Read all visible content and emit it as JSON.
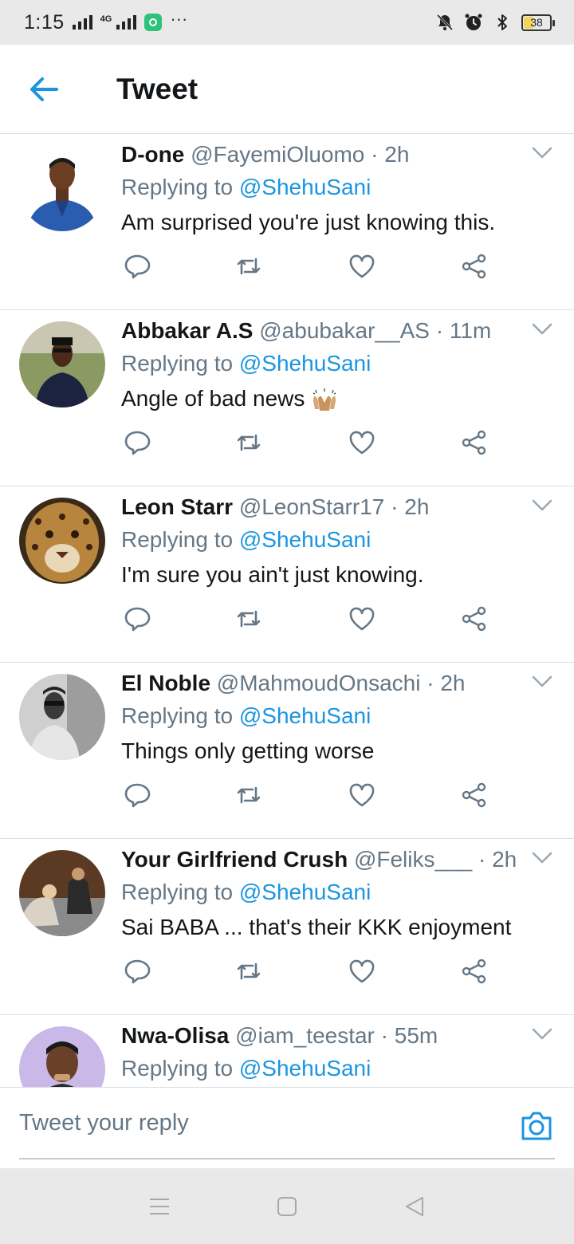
{
  "status_bar": {
    "time": "1:15",
    "network": "4G",
    "battery": "38",
    "icons": [
      "signal-icon",
      "signal-4g-icon",
      "app-notification-icon",
      "more-dots-icon",
      "mute-vibrate-icon",
      "alarm-icon",
      "bluetooth-icon",
      "battery-icon"
    ]
  },
  "header": {
    "back_icon": "back-arrow-icon",
    "title": "Tweet"
  },
  "colors": {
    "accent": "#1b95e0",
    "text_primary": "#14171a",
    "text_secondary": "#657786",
    "divider": "#d9dee2"
  },
  "tweets": [
    {
      "name": "D-one",
      "handle": "@FayemiOluomo",
      "time": "2h",
      "replying_prefix": "Replying to",
      "replying_to": "@ShehuSani",
      "text": "Am surprised you're just knowing this."
    },
    {
      "name": "Abbakar A.S",
      "handle": "@abubakar__AS",
      "time": "11m",
      "replying_prefix": "Replying to",
      "replying_to": "@ShehuSani",
      "text": "Angle of bad news",
      "emoji": "raising-hands-emoji"
    },
    {
      "name": "Leon Starr",
      "handle": "@LeonStarr17",
      "time": "2h",
      "replying_prefix": "Replying to",
      "replying_to": "@ShehuSani",
      "text": "I'm sure you ain't just knowing."
    },
    {
      "name": "El Noble",
      "handle": "@MahmoudOnsachi",
      "time": "2h",
      "replying_prefix": "Replying to",
      "replying_to": "@ShehuSani",
      "text": "Things only getting worse"
    },
    {
      "name": "Your Girlfriend Crush",
      "handle": "@Feliks___",
      "time": "2h",
      "replying_prefix": "Replying to",
      "replying_to": "@ShehuSani",
      "text": "Sai BABA ... that's their KKK enjoyment"
    },
    {
      "name": "Nwa-Olisa",
      "handle": "@iam_teestar",
      "time": "55m",
      "replying_prefix": "Replying to",
      "replying_to": "@ShehuSani",
      "text": ""
    }
  ],
  "actions": {
    "icons": [
      "reply-icon",
      "retweet-icon",
      "like-icon",
      "share-icon"
    ]
  },
  "reply_bar": {
    "placeholder": "Tweet your reply",
    "camera_icon": "camera-icon"
  },
  "nav_bar": {
    "icons": [
      "menu-icon",
      "home-square-icon",
      "back-triangle-icon"
    ]
  }
}
